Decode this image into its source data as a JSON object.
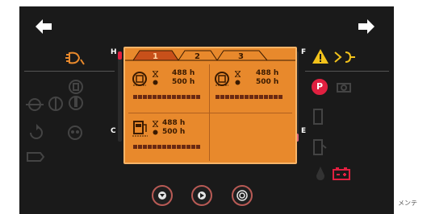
{
  "dashboard": {
    "tabs": [
      "1",
      "2",
      "3"
    ],
    "gauges": {
      "left_top": "H",
      "left_bottom": "C",
      "right_top": "F",
      "right_bottom": "E"
    },
    "cells": [
      {
        "hours1": "488 h",
        "hours2": "500 h",
        "icon": "engine-icon"
      },
      {
        "hours1": "488 h",
        "hours2": "500 h",
        "icon": "engine-icon"
      },
      {
        "hours1": "488 h",
        "hours2": "500 h",
        "icon": "fuel-filter-icon"
      }
    ],
    "buttons": [
      "down-icon",
      "play-icon",
      "target-icon"
    ],
    "parking_label": "P",
    "accent": "#e8892c",
    "warning": "#f2c21b",
    "alert": "#e02040"
  },
  "caption": "メンテ"
}
